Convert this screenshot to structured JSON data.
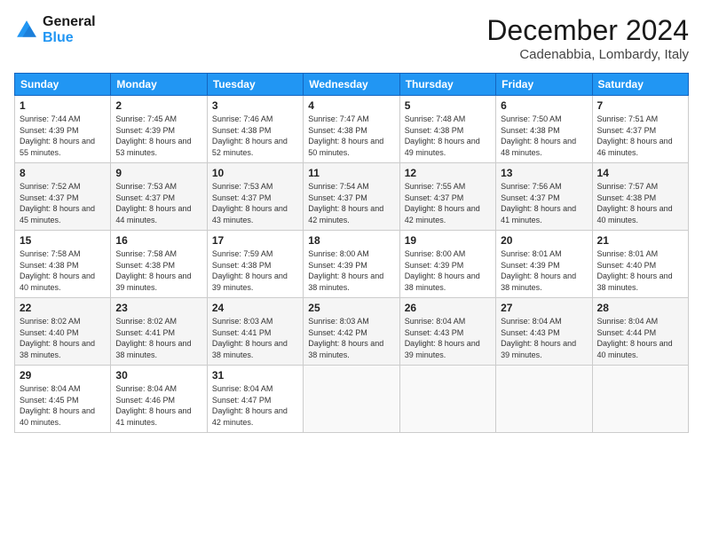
{
  "header": {
    "logo_line1": "General",
    "logo_line2": "Blue",
    "title": "December 2024",
    "location": "Cadenabbia, Lombardy, Italy"
  },
  "columns": [
    "Sunday",
    "Monday",
    "Tuesday",
    "Wednesday",
    "Thursday",
    "Friday",
    "Saturday"
  ],
  "weeks": [
    [
      {
        "day": "1",
        "sunrise": "7:44 AM",
        "sunset": "4:39 PM",
        "daylight": "8 hours and 55 minutes."
      },
      {
        "day": "2",
        "sunrise": "7:45 AM",
        "sunset": "4:39 PM",
        "daylight": "8 hours and 53 minutes."
      },
      {
        "day": "3",
        "sunrise": "7:46 AM",
        "sunset": "4:38 PM",
        "daylight": "8 hours and 52 minutes."
      },
      {
        "day": "4",
        "sunrise": "7:47 AM",
        "sunset": "4:38 PM",
        "daylight": "8 hours and 50 minutes."
      },
      {
        "day": "5",
        "sunrise": "7:48 AM",
        "sunset": "4:38 PM",
        "daylight": "8 hours and 49 minutes."
      },
      {
        "day": "6",
        "sunrise": "7:50 AM",
        "sunset": "4:38 PM",
        "daylight": "8 hours and 48 minutes."
      },
      {
        "day": "7",
        "sunrise": "7:51 AM",
        "sunset": "4:37 PM",
        "daylight": "8 hours and 46 minutes."
      }
    ],
    [
      {
        "day": "8",
        "sunrise": "7:52 AM",
        "sunset": "4:37 PM",
        "daylight": "8 hours and 45 minutes."
      },
      {
        "day": "9",
        "sunrise": "7:53 AM",
        "sunset": "4:37 PM",
        "daylight": "8 hours and 44 minutes."
      },
      {
        "day": "10",
        "sunrise": "7:53 AM",
        "sunset": "4:37 PM",
        "daylight": "8 hours and 43 minutes."
      },
      {
        "day": "11",
        "sunrise": "7:54 AM",
        "sunset": "4:37 PM",
        "daylight": "8 hours and 42 minutes."
      },
      {
        "day": "12",
        "sunrise": "7:55 AM",
        "sunset": "4:37 PM",
        "daylight": "8 hours and 42 minutes."
      },
      {
        "day": "13",
        "sunrise": "7:56 AM",
        "sunset": "4:37 PM",
        "daylight": "8 hours and 41 minutes."
      },
      {
        "day": "14",
        "sunrise": "7:57 AM",
        "sunset": "4:38 PM",
        "daylight": "8 hours and 40 minutes."
      }
    ],
    [
      {
        "day": "15",
        "sunrise": "7:58 AM",
        "sunset": "4:38 PM",
        "daylight": "8 hours and 40 minutes."
      },
      {
        "day": "16",
        "sunrise": "7:58 AM",
        "sunset": "4:38 PM",
        "daylight": "8 hours and 39 minutes."
      },
      {
        "day": "17",
        "sunrise": "7:59 AM",
        "sunset": "4:38 PM",
        "daylight": "8 hours and 39 minutes."
      },
      {
        "day": "18",
        "sunrise": "8:00 AM",
        "sunset": "4:39 PM",
        "daylight": "8 hours and 38 minutes."
      },
      {
        "day": "19",
        "sunrise": "8:00 AM",
        "sunset": "4:39 PM",
        "daylight": "8 hours and 38 minutes."
      },
      {
        "day": "20",
        "sunrise": "8:01 AM",
        "sunset": "4:39 PM",
        "daylight": "8 hours and 38 minutes."
      },
      {
        "day": "21",
        "sunrise": "8:01 AM",
        "sunset": "4:40 PM",
        "daylight": "8 hours and 38 minutes."
      }
    ],
    [
      {
        "day": "22",
        "sunrise": "8:02 AM",
        "sunset": "4:40 PM",
        "daylight": "8 hours and 38 minutes."
      },
      {
        "day": "23",
        "sunrise": "8:02 AM",
        "sunset": "4:41 PM",
        "daylight": "8 hours and 38 minutes."
      },
      {
        "day": "24",
        "sunrise": "8:03 AM",
        "sunset": "4:41 PM",
        "daylight": "8 hours and 38 minutes."
      },
      {
        "day": "25",
        "sunrise": "8:03 AM",
        "sunset": "4:42 PM",
        "daylight": "8 hours and 38 minutes."
      },
      {
        "day": "26",
        "sunrise": "8:04 AM",
        "sunset": "4:43 PM",
        "daylight": "8 hours and 39 minutes."
      },
      {
        "day": "27",
        "sunrise": "8:04 AM",
        "sunset": "4:43 PM",
        "daylight": "8 hours and 39 minutes."
      },
      {
        "day": "28",
        "sunrise": "8:04 AM",
        "sunset": "4:44 PM",
        "daylight": "8 hours and 40 minutes."
      }
    ],
    [
      {
        "day": "29",
        "sunrise": "8:04 AM",
        "sunset": "4:45 PM",
        "daylight": "8 hours and 40 minutes."
      },
      {
        "day": "30",
        "sunrise": "8:04 AM",
        "sunset": "4:46 PM",
        "daylight": "8 hours and 41 minutes."
      },
      {
        "day": "31",
        "sunrise": "8:04 AM",
        "sunset": "4:47 PM",
        "daylight": "8 hours and 42 minutes."
      },
      null,
      null,
      null,
      null
    ]
  ],
  "labels": {
    "sunrise": "Sunrise:",
    "sunset": "Sunset:",
    "daylight": "Daylight:"
  }
}
